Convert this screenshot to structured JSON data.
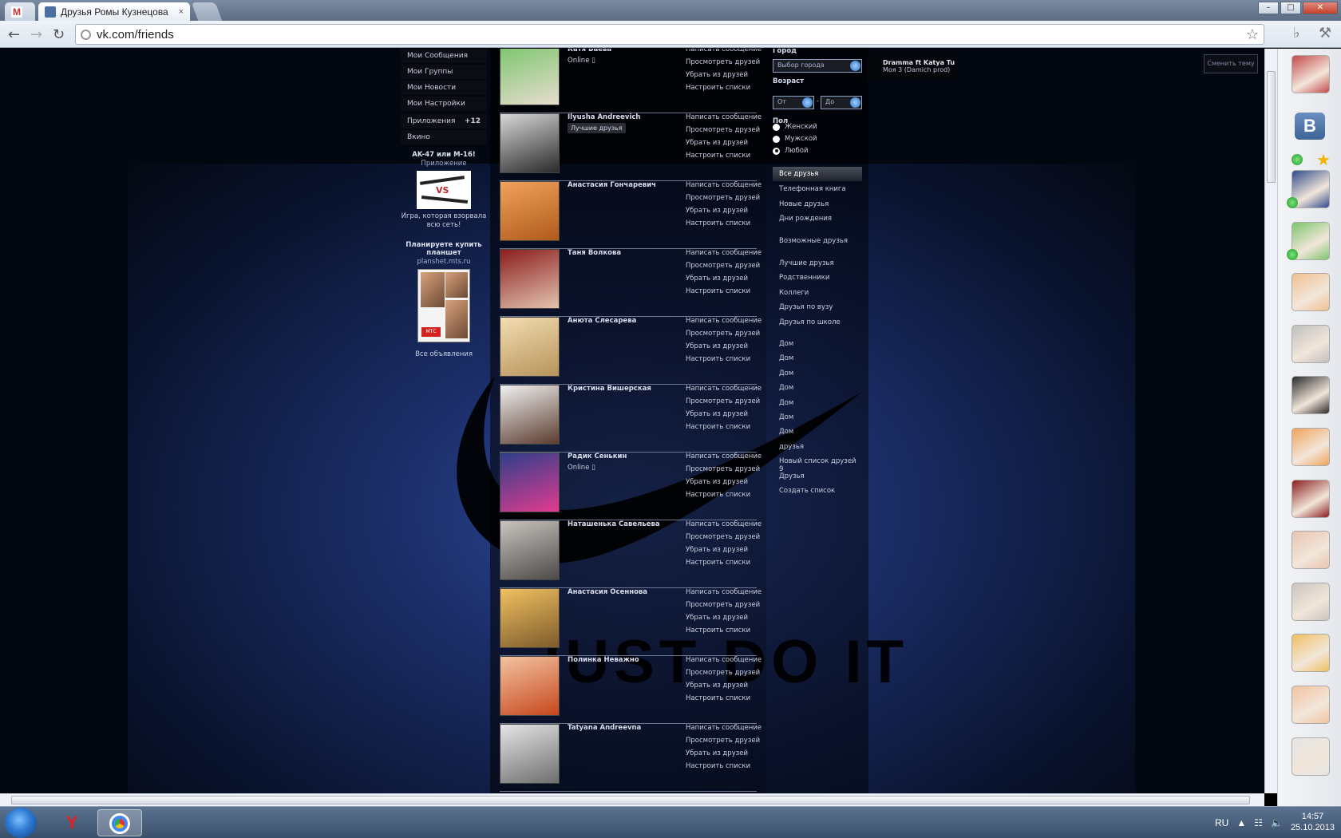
{
  "browser": {
    "tabs": [
      {
        "label": "M"
      },
      {
        "label": "Друзья Ромы Кузнецова",
        "close": "×"
      },
      {
        "label": ""
      }
    ],
    "url": "vk.com/friends",
    "window_buttons": [
      "–",
      "□",
      "✕"
    ]
  },
  "left_menu": {
    "items": [
      "Мои Сообщения",
      "Мои Группы",
      "Мои Новости",
      "Мои Настройки"
    ],
    "apps_label": "Приложения",
    "apps_count": "+12",
    "vkino": "Вкино"
  },
  "ads": [
    {
      "title": "AK-47 или M-16!",
      "subtitle": "Приложение",
      "image_text": "VS",
      "description": "Игра, которая взорвала всю сеть!"
    },
    {
      "title": "Планируете купить планшет",
      "subtitle": "planshet.mts.ru",
      "image_text": "МТС"
    }
  ],
  "all_ads": "Все объявления",
  "friends": [
    {
      "name": "Катя Баева",
      "status": "Online ▯",
      "colors": [
        "#7cc66d",
        "#e8dcd0"
      ]
    },
    {
      "name": "Ilyusha Andreevich",
      "badge": "Лучшие друзья",
      "colors": [
        "#d7d7d7",
        "#2a2a2a"
      ]
    },
    {
      "name": "Анастасия Гончаревич",
      "colors": [
        "#f0a35a",
        "#b05a1c"
      ]
    },
    {
      "name": "Таня Волкова",
      "colors": [
        "#8b1d1d",
        "#e2c4b0"
      ]
    },
    {
      "name": "Анюта Слесарева",
      "colors": [
        "#f3ddb2",
        "#b6935a"
      ]
    },
    {
      "name": "Кристина Вишерская",
      "colors": [
        "#f1f1f1",
        "#5a3b2e"
      ]
    },
    {
      "name": "Радик Сенькин",
      "status": "Online ▯",
      "colors": [
        "#2d3f8a",
        "#e23b8f"
      ]
    },
    {
      "name": "Наташенька Савельева",
      "colors": [
        "#c9c4bf",
        "#4c4a48"
      ]
    },
    {
      "name": "Анастасия Осеннова",
      "colors": [
        "#f0c060",
        "#7d5b2c"
      ]
    },
    {
      "name": "Полинка Неважно",
      "colors": [
        "#f2c3a1",
        "#c7471d"
      ]
    },
    {
      "name": "Tatyana Andreevna",
      "colors": [
        "#e5e5e5",
        "#6e6e6e"
      ]
    }
  ],
  "friend_actions": [
    "Написать сообщение",
    "Просмотреть друзей",
    "Убрать из друзей",
    "Настроить списки"
  ],
  "filters": {
    "city_label": "Город",
    "city_placeholder": "Выбор города",
    "age_label": "Возраст",
    "age_from": "От",
    "age_dash": "-",
    "age_to": "До",
    "gender_label": "Пол",
    "genders": [
      "Женский",
      "Мужской",
      "Любой"
    ],
    "gender_selected": 2
  },
  "lists": {
    "active": "Все друзья",
    "group1": [
      "Телефонная книга",
      "Новые друзья",
      "Дни рождения"
    ],
    "possible": "Возможные друзья",
    "group2": [
      "Лучшие друзья",
      "Родственники",
      "Коллеги",
      "Друзья по вузу",
      "Друзья по школе"
    ],
    "group3": [
      "Дом",
      "Дом",
      "Дом",
      "Дом",
      "Дом",
      "Дом",
      "Дом",
      "друзья",
      "Новый список друзей 9",
      "Друзья",
      "Создать список"
    ]
  },
  "music": {
    "title": "Dramma ft Katya Tu",
    "subtitle": "Моя 3 (Damich prod)"
  },
  "theme_button": "Сменить тему",
  "background_text": "JUST DO IT",
  "sidebar": {
    "vk_letter": "B",
    "avatars": [
      "#c44a4a",
      "#2f4a8c",
      "#7cc66d",
      "#f0c090",
      "#bfbfbf",
      "#2a2a2a",
      "#f0a35a",
      "#8b1d1d",
      "#e8c4b0",
      "#c9c4bf",
      "#f0c060",
      "#f2c3a1",
      "#e5e5e5"
    ]
  },
  "taskbar": {
    "yandex": "Y",
    "lang": "RU",
    "time": "14:57",
    "date": "25.10.2013"
  }
}
